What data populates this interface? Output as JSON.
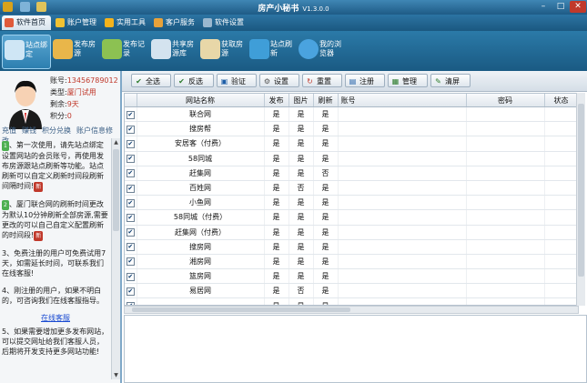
{
  "window": {
    "title": "房产小秘书",
    "version": "V1.3.0.0"
  },
  "tabs": [
    {
      "label": "软件首页",
      "active": true
    },
    {
      "label": "账户管理",
      "active": false
    },
    {
      "label": "实用工具",
      "active": false
    },
    {
      "label": "客户服务",
      "active": false
    },
    {
      "label": "软件设置",
      "active": false
    }
  ],
  "toolbar": [
    {
      "label": "站点绑定",
      "icon": "bind-icon"
    },
    {
      "label": "发布房源",
      "icon": "publish-icon"
    },
    {
      "label": "发布记录",
      "icon": "record-icon"
    },
    {
      "label": "共享房源库",
      "icon": "share-library-icon"
    },
    {
      "label": "获取房源",
      "icon": "fetch-icon"
    },
    {
      "label": "站点刷新",
      "icon": "refresh-icon"
    },
    {
      "label": "我的浏览器",
      "icon": "browser-icon"
    }
  ],
  "account": {
    "account_key": "账号:",
    "account_val": "13456789012",
    "type_key": "类型:",
    "type_val": "厦门试用",
    "remain_key": "剩余:",
    "remain_val": "9天",
    "points_key": "积分:",
    "points_val": "0"
  },
  "links": [
    "充值",
    "赚钱",
    "积分兑换",
    "账户信息修改"
  ],
  "notes": [
    {
      "badge": "1",
      "text": "、第一次使用，请先站点绑定设置网站的会员账号，再使用发布房源跟站点刷新等功能。站点刷新可以自定义刷新时间段刷新间隔时间!"
    },
    {
      "badge": "2",
      "text": "、厦门联合网的刷新时间更改为默认10分钟刷新全部房源,需要更改的可以自己自定义配置刷新的时间段!"
    },
    {
      "badge": "3",
      "text": "、免费注册的用户可免费试用7天，如需延长时间，可联系我们在线客服!"
    },
    {
      "badge": "4",
      "text": "、刚注册的用户，如果不明白的，可咨询我们在线客服指导。"
    },
    {
      "badge": "5",
      "text": "、如果需要增加更多发布网站，可以提交网址给我们客服人员，后期将开发支持更多网站功能!"
    }
  ],
  "new_label": "新",
  "online_service": "在线客服",
  "actions": [
    "全选",
    "反选",
    "验证",
    "设置",
    "重置",
    "注册",
    "管理",
    "清屏"
  ],
  "table": {
    "columns": [
      "网站名称",
      "发布",
      "图片",
      "刷新",
      "账号",
      "密码",
      "状态"
    ],
    "rows": [
      {
        "name": "联合网",
        "pub": "是",
        "img": "是",
        "ref": "是"
      },
      {
        "name": "搜房帮",
        "pub": "是",
        "img": "是",
        "ref": "是"
      },
      {
        "name": "安居客（付费）",
        "pub": "是",
        "img": "是",
        "ref": "是"
      },
      {
        "name": "58同城",
        "pub": "是",
        "img": "是",
        "ref": "是"
      },
      {
        "name": "赶集网",
        "pub": "是",
        "img": "是",
        "ref": "否"
      },
      {
        "name": "百姓网",
        "pub": "是",
        "img": "否",
        "ref": "是"
      },
      {
        "name": "小鱼网",
        "pub": "是",
        "img": "是",
        "ref": "是"
      },
      {
        "name": "58同城（付费）",
        "pub": "是",
        "img": "是",
        "ref": "是"
      },
      {
        "name": "赶集网（付费）",
        "pub": "是",
        "img": "是",
        "ref": "是"
      },
      {
        "name": "搜房网",
        "pub": "是",
        "img": "是",
        "ref": "是"
      },
      {
        "name": "湘房网",
        "pub": "是",
        "img": "是",
        "ref": "是"
      },
      {
        "name": "篮房网",
        "pub": "是",
        "img": "是",
        "ref": "是"
      },
      {
        "name": "易居网",
        "pub": "是",
        "img": "否",
        "ref": "是"
      },
      {
        "name": "",
        "pub": "是",
        "img": "是",
        "ref": "是"
      }
    ]
  },
  "colors": {
    "chrome": "#1e5b86",
    "accent_red": "#c0392b",
    "panel": "#f4f6f8"
  }
}
